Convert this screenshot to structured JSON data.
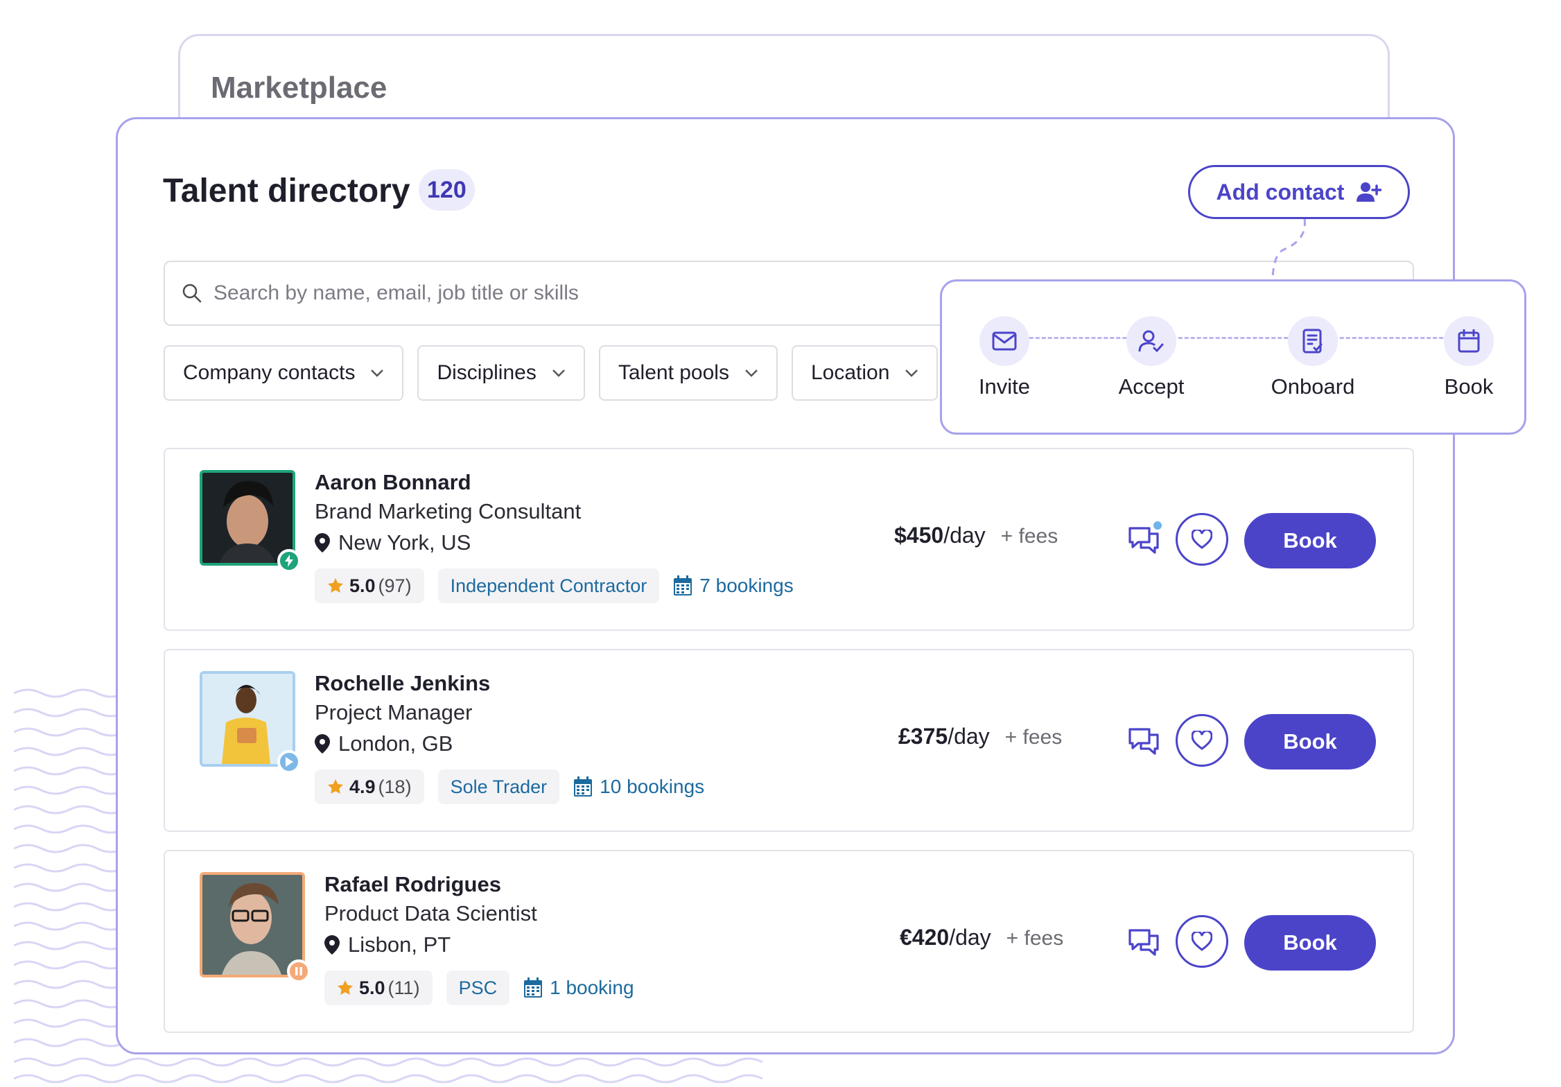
{
  "marketplace": {
    "title": "Marketplace"
  },
  "directory": {
    "title": "Talent directory",
    "count": "120",
    "add_contact_label": "Add contact"
  },
  "search": {
    "placeholder": "Search by name, email, job title or skills"
  },
  "filters": [
    {
      "label": "Company contacts"
    },
    {
      "label": "Disciplines"
    },
    {
      "label": "Talent pools"
    },
    {
      "label": "Location"
    }
  ],
  "workflow": {
    "steps": [
      {
        "label": "Invite",
        "icon": "mail-icon"
      },
      {
        "label": "Accept",
        "icon": "user-check-icon"
      },
      {
        "label": "Onboard",
        "icon": "document-check-icon"
      },
      {
        "label": "Book",
        "icon": "calendar-icon"
      }
    ]
  },
  "talents": [
    {
      "name": "Aaron Bonnard",
      "job": "Brand Marketing Consultant",
      "location": "New York, US",
      "rating": "5.0",
      "reviews": "(97)",
      "contract_type": "Independent Contractor",
      "bookings": "7 bookings",
      "price": "$450",
      "per": "/day",
      "fees": "+ fees",
      "book_label": "Book",
      "status_icon": "lightning-icon",
      "status_color": "#1ea37a",
      "avatar_border": "#1ea37a",
      "unread_message": true
    },
    {
      "name": "Rochelle Jenkins",
      "job": "Project Manager",
      "location": "London, GB",
      "rating": "4.9",
      "reviews": "(18)",
      "contract_type": "Sole Trader",
      "bookings": "10 bookings",
      "price": "£375",
      "per": "/day",
      "fees": "+ fees",
      "book_label": "Book",
      "status_icon": "play-icon",
      "status_color": "#7fb8e8",
      "avatar_border": "#a9cff0",
      "unread_message": false
    },
    {
      "name": "Rafael Rodrigues",
      "job": "Product Data Scientist",
      "location": "Lisbon, PT",
      "rating": "5.0",
      "reviews": "(11)",
      "contract_type": "PSC",
      "bookings": "1 booking",
      "price": "€420",
      "per": "/day",
      "fees": "+ fees",
      "book_label": "Book",
      "status_icon": "pause-icon",
      "status_color": "#f4a977",
      "avatar_border": "#f4a977",
      "unread_message": false
    }
  ],
  "colors": {
    "accent": "#4b44c9",
    "card_border": "#a7a2ec",
    "link_blue": "#1c6a9e",
    "star": "#f0a020"
  }
}
